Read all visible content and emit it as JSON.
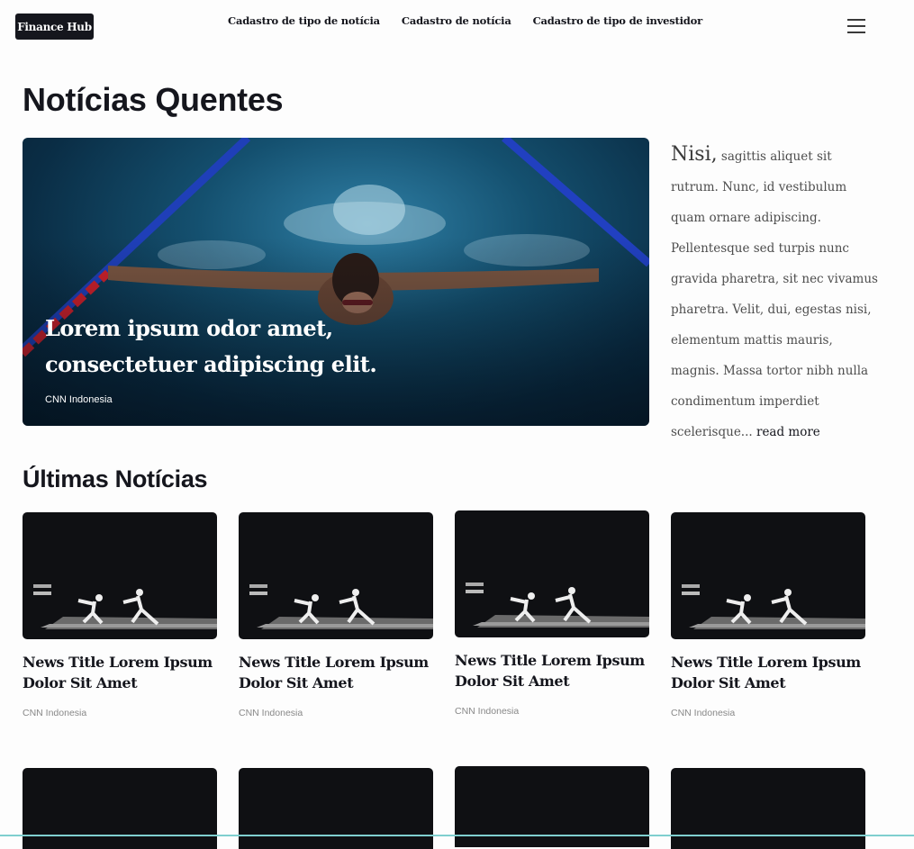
{
  "brand": {
    "logo": "Finance Hub"
  },
  "nav": {
    "items": [
      "Cadastro de tipo de notícia",
      "Cadastro de notícia",
      "Cadastro de tipo de investidor"
    ]
  },
  "hot": {
    "heading": "Notícias Quentes",
    "featured": {
      "title": "Lorem ipsum odor amet, consectetuer adipiscing elit.",
      "source": "CNN Indonesia"
    },
    "excerpt": {
      "lead": "Nisi,",
      "body": "sagittis aliquet sit rutrum. Nunc, id vestibulum quam ornare adipiscing. Pellentesque sed turpis nunc gravida pharetra, sit nec vivamus pharetra. Velit, dui, egestas nisi, elementum mattis mauris, magnis. Massa tortor nibh nulla condimentum imperdiet scelerisque...",
      "more": "read more"
    }
  },
  "latest": {
    "heading": "Últimas Notícias",
    "cards": [
      {
        "title": "News Title Lorem Ipsum Dolor Sit Amet",
        "source": "CNN Indonesia"
      },
      {
        "title": "News Title Lorem Ipsum Dolor Sit Amet",
        "source": "CNN Indonesia"
      },
      {
        "title": "News Title Lorem Ipsum Dolor Sit Amet",
        "source": "CNN Indonesia"
      },
      {
        "title": "News Title Lorem Ipsum Dolor Sit Amet",
        "source": "CNN Indonesia"
      }
    ]
  },
  "icons": {
    "menu": "hamburger-menu-icon"
  },
  "colors": {
    "dark": "#15161d",
    "accent_line": "#7fcfcf"
  }
}
